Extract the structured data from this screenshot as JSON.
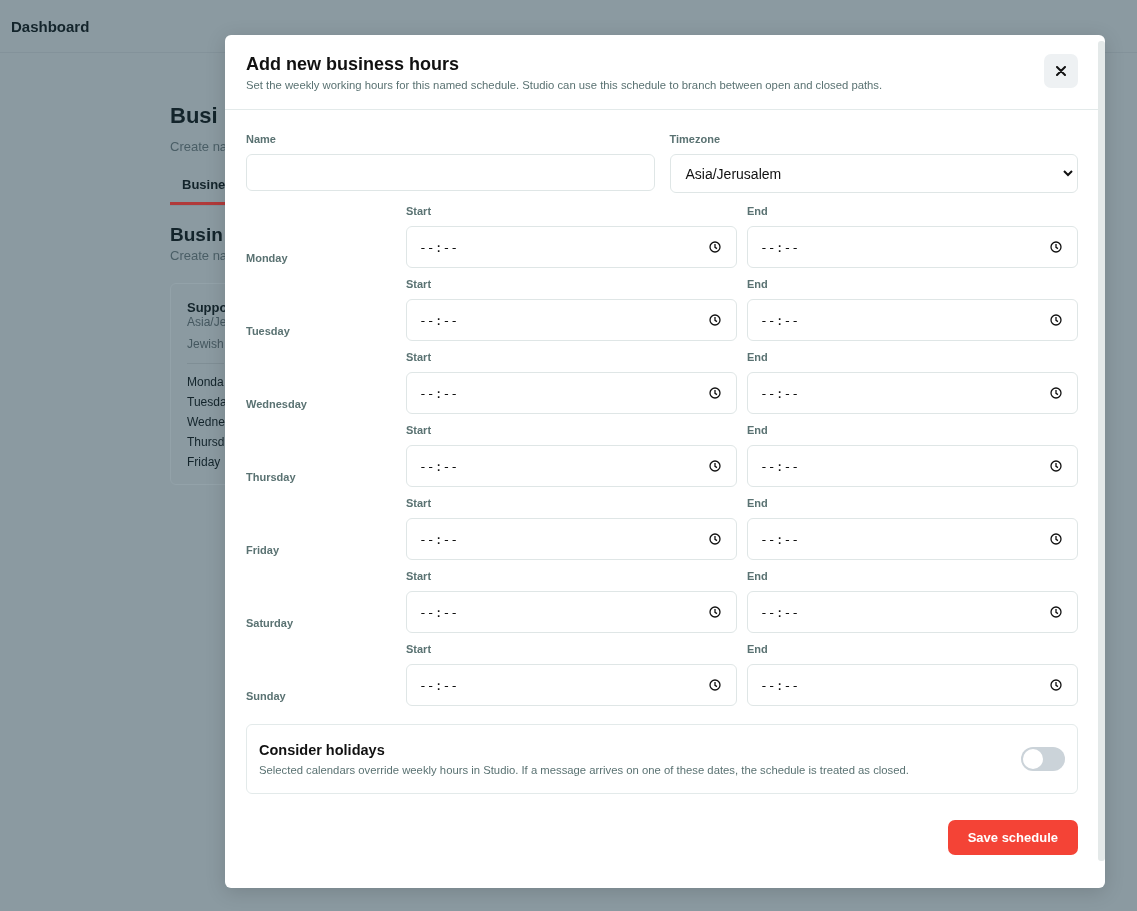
{
  "page": {
    "title": "Dashboard",
    "heading": "Busi",
    "subtitle": "Create na",
    "tabs": [
      {
        "label": "Busine",
        "selected": true
      }
    ],
    "section_heading": "Busin",
    "section_subtitle": "Create na",
    "card": {
      "title": "Suppo",
      "timezone": "Asia/Je",
      "calendar": "Jewish",
      "days": [
        "Monda",
        "Tuesda",
        "Wedne",
        "Thursd",
        "Friday"
      ]
    }
  },
  "dialog": {
    "title": "Add new business hours",
    "subtitle": "Set the weekly working hours for this named schedule. Studio can use this schedule to branch between open and closed paths.",
    "name": {
      "label": "Name"
    },
    "timezone": {
      "label": "Timezone",
      "value": "Asia/Jerusalem"
    },
    "days": [
      {
        "day": "Monday",
        "start_label": "Start",
        "start": "--:--",
        "end_label": "End",
        "end": "--:--"
      },
      {
        "day": "Tuesday",
        "start_label": "Start",
        "start": "--:--",
        "end_label": "End",
        "end": "--:--"
      },
      {
        "day": "Wednesday",
        "start_label": "Start",
        "start": "--:--",
        "end_label": "End",
        "end": "--:--"
      },
      {
        "day": "Thursday",
        "start_label": "Start",
        "start": "--:--",
        "end_label": "End",
        "end": "--:--"
      },
      {
        "day": "Friday",
        "start_label": "Start",
        "start": "--:--",
        "end_label": "End",
        "end": "--:--"
      },
      {
        "day": "Saturday",
        "start_label": "Start",
        "start": "--:--",
        "end_label": "End",
        "end": "--:--"
      },
      {
        "day": "Sunday",
        "start_label": "Start",
        "start": "--:--",
        "end_label": "End",
        "end": "--:--"
      }
    ],
    "holidays": {
      "title": "Consider holidays",
      "description": "Selected calendars override weekly hours in Studio. If a message arrives on one of these dates, the schedule is treated as closed.",
      "on": false
    },
    "save_button": "Save schedule"
  }
}
